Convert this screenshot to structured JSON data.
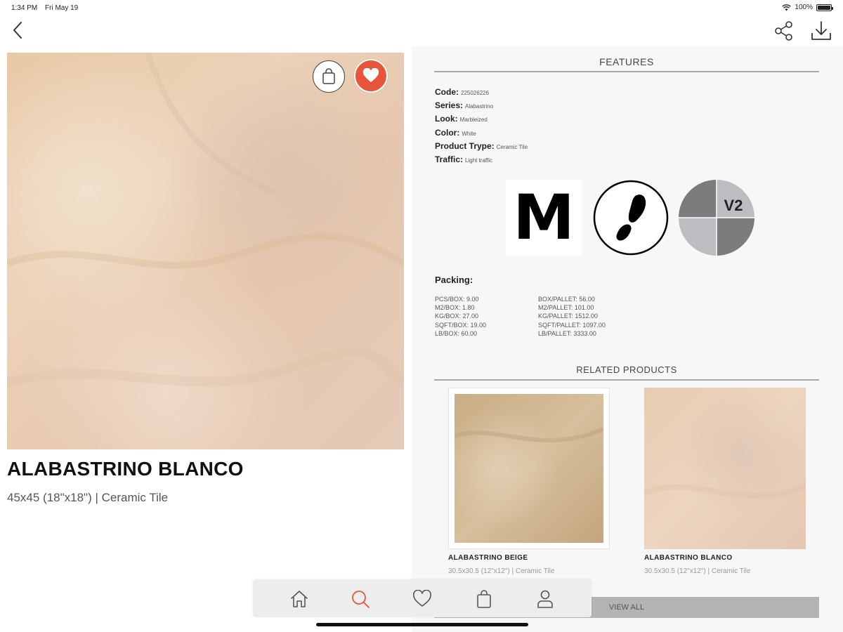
{
  "status_bar": {
    "time": "1:34 PM",
    "date": "Fri May 19",
    "battery": "100%"
  },
  "nav": {
    "back_icon": "chevron-left-icon",
    "share_icon": "share-icon",
    "download_icon": "download-icon"
  },
  "product": {
    "title": "ALABASTRINO BLANCO",
    "subtitle": "45x45 (18\"x18\") | Ceramic Tile",
    "accent_color": "#e8553a"
  },
  "features": {
    "heading": "FEATURES",
    "items": [
      {
        "label": "Code:",
        "value": "225026226"
      },
      {
        "label": "Series:",
        "value": "Alabastrino"
      },
      {
        "label": "Look:",
        "value": "Marbleized"
      },
      {
        "label": "Color:",
        "value": "White"
      },
      {
        "label": "Product Trype:",
        "value": "Ceramic Tile"
      },
      {
        "label": "Traffic:",
        "value": "Light traffic"
      }
    ],
    "badges": {
      "m_letter": "M",
      "v2_label": "V2"
    }
  },
  "packing": {
    "title": "Packing:",
    "left": [
      "PCS/BOX: 9.00",
      "M2/BOX: 1.80",
      "KG/BOX: 27.00",
      "SQFT/BOX: 19.00",
      "LB/BOX: 60.00"
    ],
    "right": [
      "BOX/PALLET: 56.00",
      "M2/PALLET: 101.00",
      "KG/PALLET: 1512.00",
      "SQFT/PALLET: 1097.00",
      "LB/PALLET: 3333.00"
    ]
  },
  "related": {
    "heading": "RELATED PRODUCTS",
    "items": [
      {
        "name": "ALABASTRINO BEIGE",
        "size": "30.5x30.5 (12\"x12\") | Ceramic Tile"
      },
      {
        "name": "ALABASTRINO BLANCO",
        "size": "30.5x30.5 (12\"x12\") | Ceramic Tile"
      }
    ],
    "view_all": "VIEW ALL"
  },
  "tab_bar": {
    "items": [
      {
        "icon": "home-icon",
        "active": false
      },
      {
        "icon": "search-icon",
        "active": true
      },
      {
        "icon": "heart-icon",
        "active": false
      },
      {
        "icon": "bag-icon",
        "active": false
      },
      {
        "icon": "user-icon",
        "active": false
      }
    ],
    "active_color": "#e8553a"
  }
}
